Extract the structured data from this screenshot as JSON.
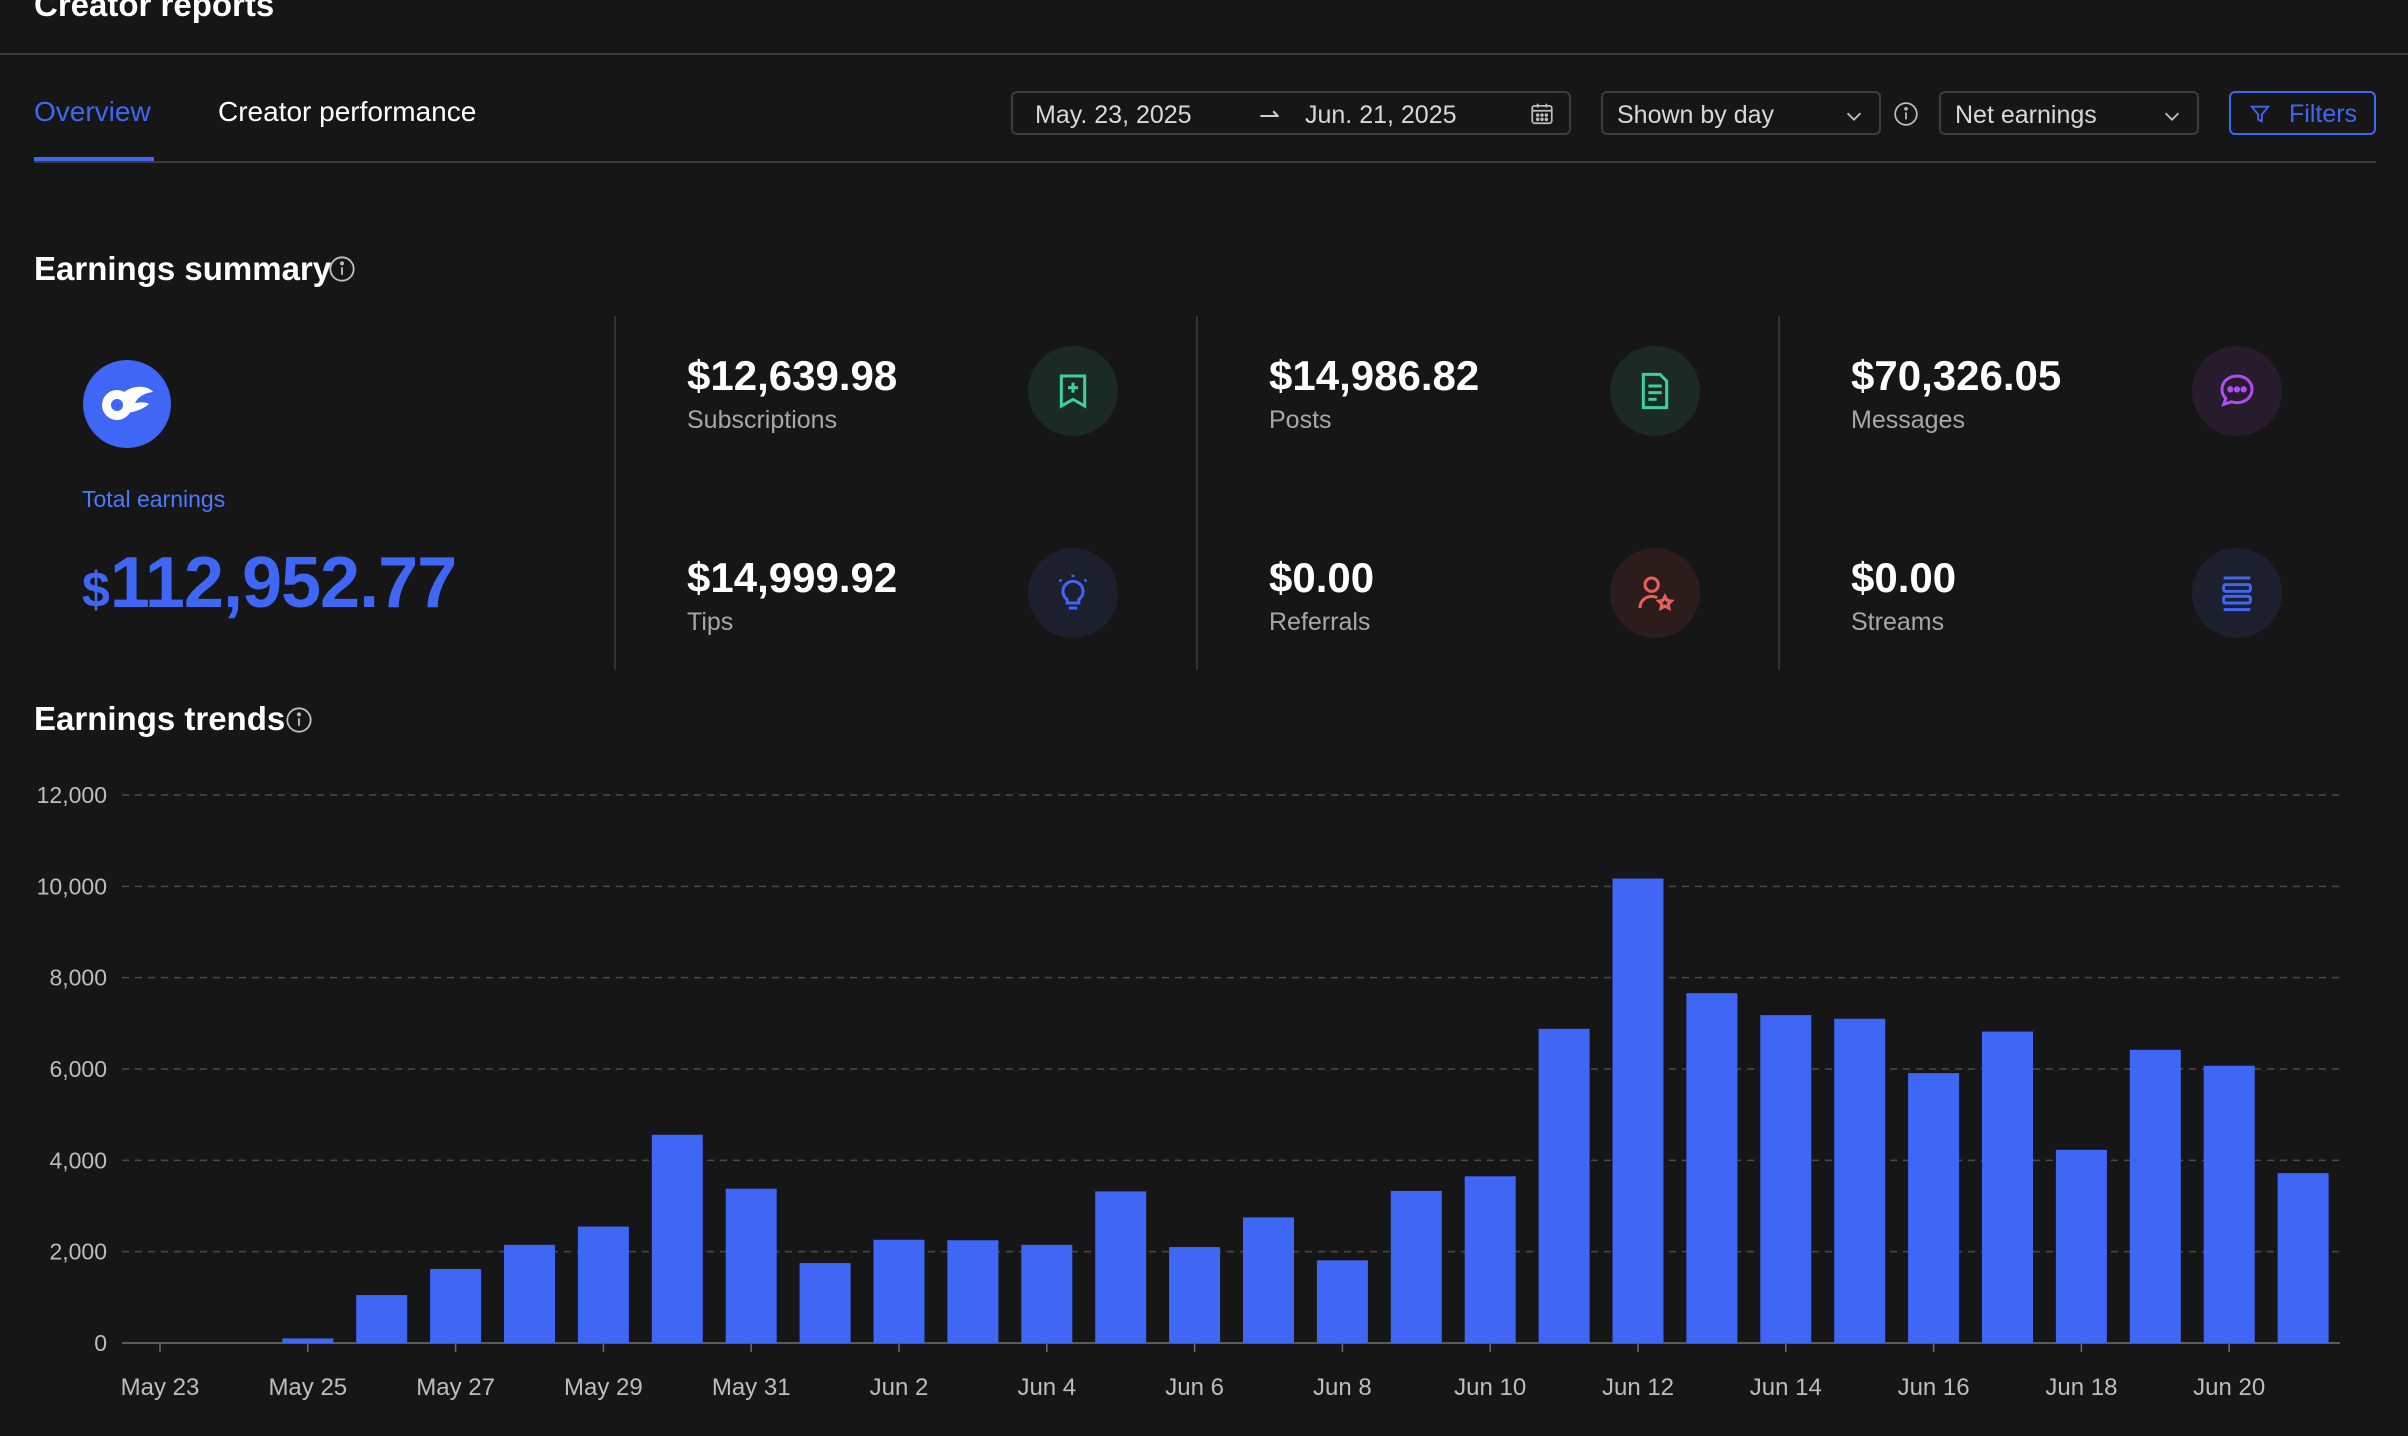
{
  "page": {
    "title": "Creator reports"
  },
  "tabs": [
    {
      "label": "Overview",
      "active": true
    },
    {
      "label": "Creator performance",
      "active": false
    }
  ],
  "controls": {
    "date_start": "May. 23, 2025",
    "date_end": "Jun. 21, 2025",
    "shown_by": "Shown by day",
    "metric": "Net earnings",
    "filters_label": "Filters"
  },
  "summary": {
    "title": "Earnings summary",
    "total_label": "Total earnings",
    "total_currency": "$",
    "total_value": "112,952.77",
    "stats": [
      {
        "value": "$12,639.98",
        "label": "Subscriptions",
        "icon": "add-bookmark-icon",
        "color": "#3ecf9c"
      },
      {
        "value": "$14,986.82",
        "label": "Posts",
        "icon": "document-icon",
        "color": "#3ecf9c"
      },
      {
        "value": "$70,326.05",
        "label": "Messages",
        "icon": "chat-bubble-icon",
        "color": "#b24bf3"
      },
      {
        "value": "$14,999.92",
        "label": "Tips",
        "icon": "lightbulb-icon",
        "color": "#3f66f5"
      },
      {
        "value": "$0.00",
        "label": "Referrals",
        "icon": "user-star-icon",
        "color": "#e8605a"
      },
      {
        "value": "$0.00",
        "label": "Streams",
        "icon": "stream-icon",
        "color": "#3f66f5"
      }
    ]
  },
  "trends": {
    "title": "Earnings trends"
  },
  "colors": {
    "accent": "#3f66f5",
    "background": "#161616"
  },
  "chart_data": {
    "type": "bar",
    "title": "",
    "xlabel": "",
    "ylabel": "",
    "ylim": [
      0,
      12000
    ],
    "yticks": [
      "0",
      "2,000",
      "4,000",
      "6,000",
      "8,000",
      "10,000",
      "12,000"
    ],
    "grid": true,
    "categories": [
      "May 23",
      "May 24",
      "May 25",
      "May 26",
      "May 27",
      "May 28",
      "May 29",
      "May 30",
      "May 31",
      "Jun 1",
      "Jun 2",
      "Jun 3",
      "Jun 4",
      "Jun 5",
      "Jun 6",
      "Jun 7",
      "Jun 8",
      "Jun 9",
      "Jun 10",
      "Jun 11",
      "Jun 12",
      "Jun 13",
      "Jun 14",
      "Jun 15",
      "Jun 16",
      "Jun 17",
      "Jun 18",
      "Jun 19",
      "Jun 20",
      "Jun 21"
    ],
    "xtick_labels": [
      "May 23",
      "May 25",
      "May 27",
      "May 29",
      "May 31",
      "Jun 2",
      "Jun 4",
      "Jun 6",
      "Jun 8",
      "Jun 10",
      "Jun 12",
      "Jun 14",
      "Jun 16",
      "Jun 18",
      "Jun 20"
    ],
    "values": [
      0,
      0,
      100,
      1050,
      1620,
      2150,
      2550,
      4560,
      3380,
      1750,
      2260,
      2250,
      2150,
      3320,
      2100,
      2750,
      1810,
      3330,
      3650,
      6880,
      10170,
      7660,
      7180,
      7100,
      5910,
      6820,
      4230,
      6420,
      6070,
      3720
    ]
  }
}
